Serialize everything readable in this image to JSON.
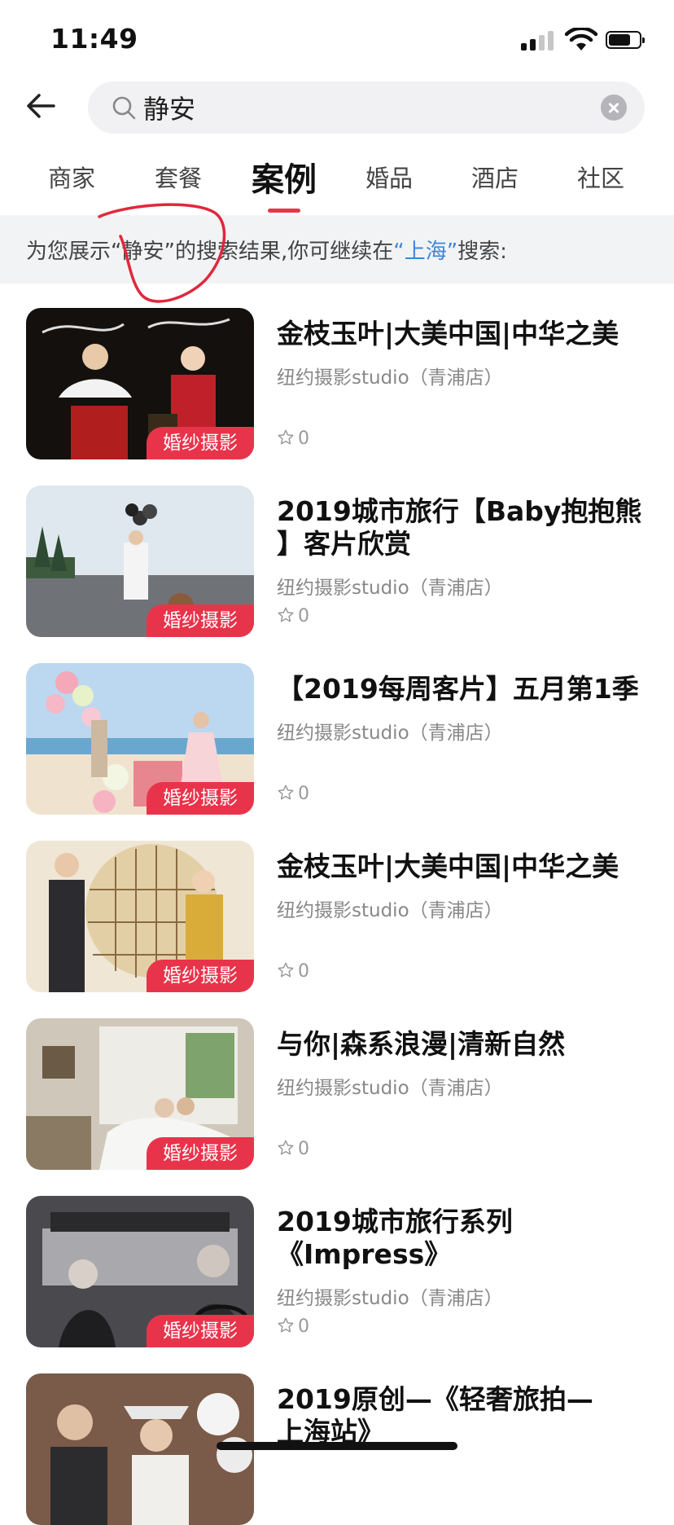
{
  "status_bar": {
    "time": "11:49"
  },
  "search": {
    "query": "静安"
  },
  "tabs": [
    {
      "label": "商家",
      "active": false
    },
    {
      "label": "套餐",
      "active": false
    },
    {
      "label": "案例",
      "active": true
    },
    {
      "label": "婚品",
      "active": false
    },
    {
      "label": "酒店",
      "active": false
    },
    {
      "label": "社区",
      "active": false
    }
  ],
  "banner": {
    "prefix": "为您展示“静安”的搜索结果,你可继续在",
    "city_link": "“上海”",
    "suffix": "搜索:"
  },
  "colors": {
    "accent": "#e8344a",
    "link": "#3e86d8",
    "banner_bg": "#f2f3f5"
  },
  "results": [
    {
      "title": "金枝玉叶|大美中国|中华之美",
      "shop": "纽约摄影studio（青浦店）",
      "likes": "0",
      "badge": "婚纱摄影"
    },
    {
      "title": "2019城市旅行【Baby抱抱熊 】客片欣赏",
      "shop": "纽约摄影studio（青浦店）",
      "likes": "0",
      "badge": "婚纱摄影"
    },
    {
      "title": "【2019每周客片】五月第1季",
      "shop": "纽约摄影studio（青浦店）",
      "likes": "0",
      "badge": "婚纱摄影"
    },
    {
      "title": "金枝玉叶|大美中国|中华之美",
      "shop": "纽约摄影studio（青浦店）",
      "likes": "0",
      "badge": "婚纱摄影"
    },
    {
      "title": "与你|森系浪漫|清新自然",
      "shop": "纽约摄影studio（青浦店）",
      "likes": "0",
      "badge": "婚纱摄影"
    },
    {
      "title": "2019城市旅行系列《Impress》",
      "shop": "纽约摄影studio（青浦店）",
      "likes": "0",
      "badge": "婚纱摄影"
    },
    {
      "title": "2019原创—《轻奢旅拍—上海站》",
      "shop": "",
      "likes": "",
      "badge": ""
    }
  ]
}
